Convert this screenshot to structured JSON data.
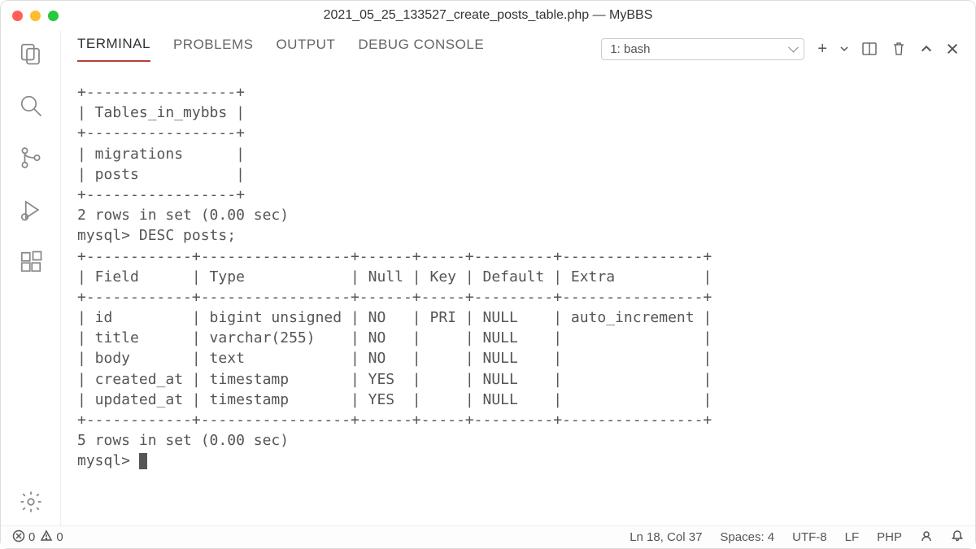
{
  "window": {
    "title": "2021_05_25_133527_create_posts_table.php — MyBBS"
  },
  "panel": {
    "tabs": [
      "TERMINAL",
      "PROBLEMS",
      "OUTPUT",
      "DEBUG CONSOLE"
    ],
    "active_tab": "TERMINAL",
    "dropdown_selected": "1: bash"
  },
  "terminal": {
    "lines": [
      "+-----------------+",
      "| Tables_in_mybbs |",
      "+-----------------+",
      "| migrations      |",
      "| posts           |",
      "+-----------------+",
      "2 rows in set (0.00 sec)",
      "",
      "mysql> DESC posts;",
      "+------------+-----------------+------+-----+---------+----------------+",
      "| Field      | Type            | Null | Key | Default | Extra          |",
      "+------------+-----------------+------+-----+---------+----------------+",
      "| id         | bigint unsigned | NO   | PRI | NULL    | auto_increment |",
      "| title      | varchar(255)    | NO   |     | NULL    |                |",
      "| body       | text            | NO   |     | NULL    |                |",
      "| created_at | timestamp       | YES  |     | NULL    |                |",
      "| updated_at | timestamp       | YES  |     | NULL    |                |",
      "+------------+-----------------+------+-----+---------+----------------+",
      "5 rows in set (0.00 sec)",
      "",
      "mysql> "
    ]
  },
  "status": {
    "errors": "0",
    "warnings": "0",
    "position": "Ln 18, Col 37",
    "indent": "Spaces: 4",
    "encoding": "UTF-8",
    "eol": "LF",
    "language": "PHP"
  }
}
